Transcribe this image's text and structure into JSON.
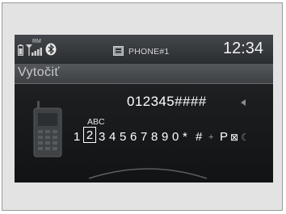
{
  "status_bar": {
    "battery_icon": "battery-icon",
    "signal_icon": "signal-icon",
    "roaming_label": "RM",
    "bluetooth_icon": "bluetooth-icon",
    "phone_icon": "phone-book-icon",
    "phone_name": "PHONE#1",
    "clock": "12:34"
  },
  "screen": {
    "title": "Vytočiť",
    "entered_number": "012345####",
    "keypad_letters": "ABC",
    "keypad": [
      {
        "label": "1"
      },
      {
        "label": "2",
        "selected": true
      },
      {
        "label": "3"
      },
      {
        "label": "4"
      },
      {
        "label": "5"
      },
      {
        "label": "6"
      },
      {
        "label": "7"
      },
      {
        "label": "8"
      },
      {
        "label": "9"
      },
      {
        "label": "0"
      },
      {
        "label": "*"
      },
      {
        "label": "#"
      },
      {
        "label": "+"
      },
      {
        "label": "P"
      },
      {
        "label": "⊠"
      },
      {
        "label": "☾"
      }
    ]
  }
}
